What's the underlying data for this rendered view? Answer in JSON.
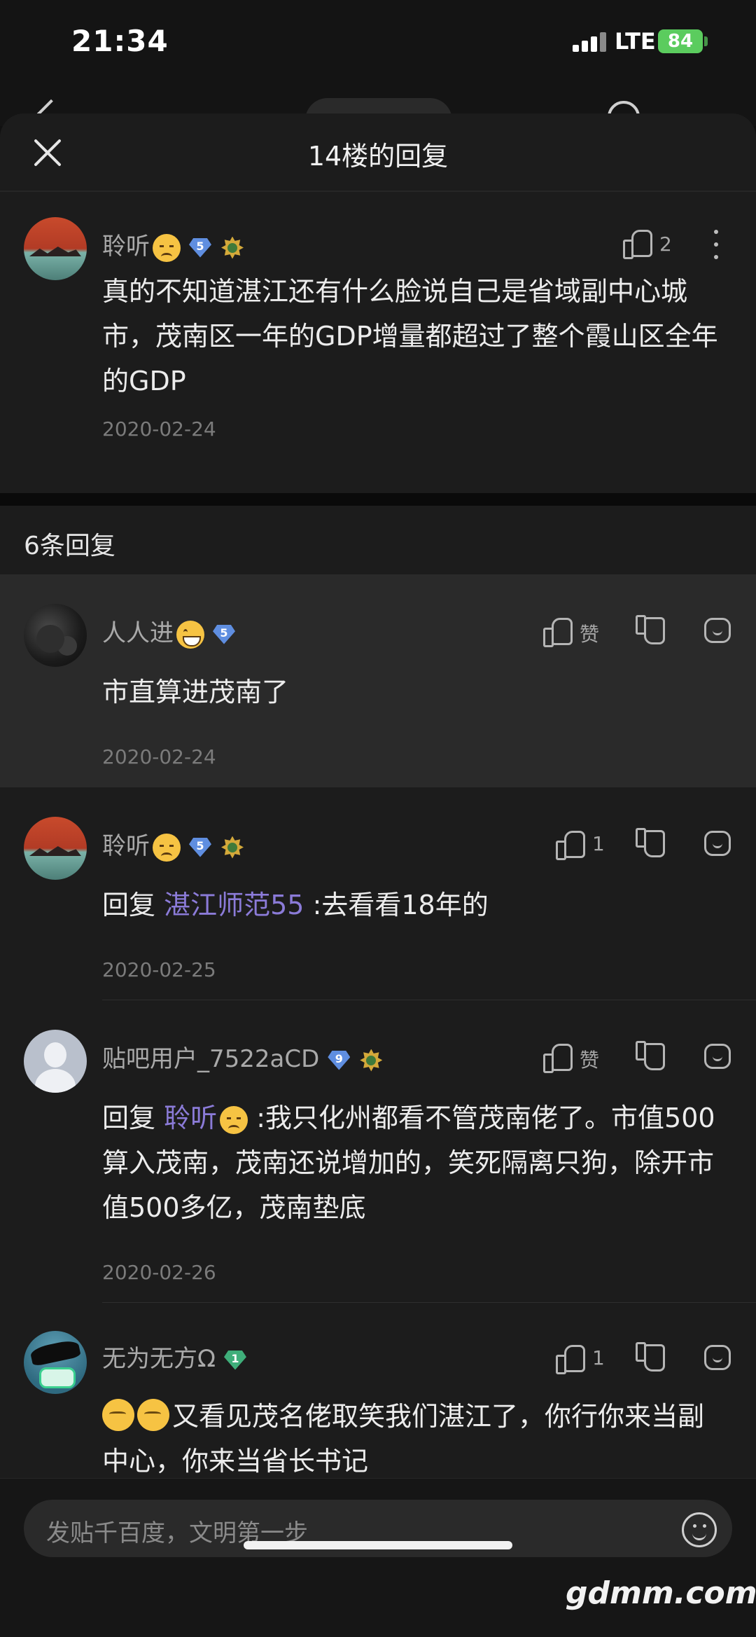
{
  "status_bar": {
    "time": "21:34",
    "network": "LTE",
    "battery": "84"
  },
  "sheet": {
    "title": "14楼的回复"
  },
  "main_post": {
    "user": "聆听",
    "level": "5",
    "likes": "2",
    "text": "真的不知道湛江还有什么脸说自己是省域副中心城市，茂南区一年的GDP增量都超过了整个霞山区全年的GDP",
    "date": "2020-02-24"
  },
  "replies_header": "6条回复",
  "replies": [
    {
      "user": "人人进",
      "level": "5",
      "like_label": "赞",
      "text": "市直算进茂南了",
      "date": "2020-02-24"
    },
    {
      "user": "聆听",
      "level": "5",
      "like_label": "1",
      "reply_prefix": "回复",
      "mention": "湛江师范55",
      "text": ":去看看18年的",
      "date": "2020-02-25"
    },
    {
      "user": "贴吧用户_7522aCD",
      "level": "9",
      "like_label": "赞",
      "reply_prefix": "回复",
      "mention": "聆听",
      "text": ":我只化州都看不管茂南佬了。市值500算入茂南，茂南还说增加的，笑死隔离只狗，除开市值500多亿，茂南垫底",
      "date": "2020-02-26"
    },
    {
      "user": "无为无方Ω",
      "level": "1",
      "like_label": "1",
      "text": "又看见茂名佬取笑我们湛江了，你行你来当副中心，你来当省长书记"
    }
  ],
  "input": {
    "placeholder": "发贴千百度，文明第一步"
  },
  "watermark": "gdmm.com"
}
